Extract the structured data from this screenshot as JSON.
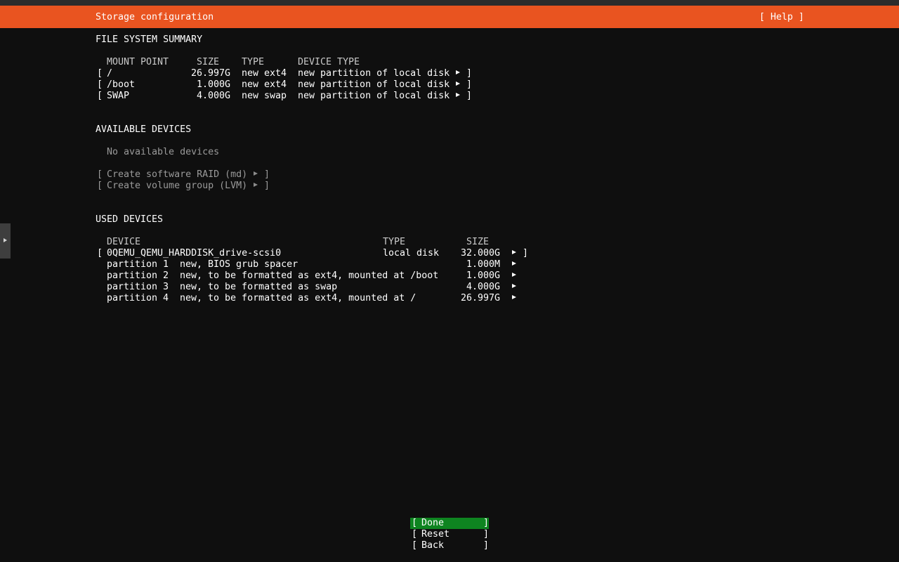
{
  "header": {
    "title": "Storage configuration",
    "help_label": "[ Help ]"
  },
  "fs_summary": {
    "title": "FILE SYSTEM SUMMARY",
    "columns": [
      "MOUNT POINT",
      "SIZE",
      "TYPE",
      "DEVICE TYPE"
    ],
    "rows": [
      {
        "mount": "/",
        "size": "26.997G",
        "type": "new ext4",
        "device_type": "new partition of local disk"
      },
      {
        "mount": "/boot",
        "size": "1.000G",
        "type": "new ext4",
        "device_type": "new partition of local disk"
      },
      {
        "mount": "SWAP",
        "size": "4.000G",
        "type": "new swap",
        "device_type": "new partition of local disk"
      }
    ]
  },
  "available": {
    "title": "AVAILABLE DEVICES",
    "empty_text": "No available devices",
    "actions": [
      {
        "label": "Create software RAID (md)"
      },
      {
        "label": "Create volume group (LVM)"
      }
    ]
  },
  "used": {
    "title": "USED DEVICES",
    "columns": [
      "DEVICE",
      "TYPE",
      "SIZE"
    ],
    "disk": {
      "name": "0QEMU_QEMU_HARDDISK_drive-scsi0",
      "type": "local disk",
      "size": "32.000G"
    },
    "partitions": [
      {
        "name": "partition 1",
        "desc": "new, BIOS grub spacer",
        "size": "1.000M"
      },
      {
        "name": "partition 2",
        "desc": "new, to be formatted as ext4, mounted at /boot",
        "size": "1.000G"
      },
      {
        "name": "partition 3",
        "desc": "new, to be formatted as swap",
        "size": "4.000G"
      },
      {
        "name": "partition 4",
        "desc": "new, to be formatted as ext4, mounted at /",
        "size": "26.997G"
      }
    ]
  },
  "buttons": {
    "done": "Done",
    "reset": "Reset",
    "back": "Back"
  },
  "colors": {
    "header": "#e95420",
    "focus": "#0e8420",
    "background": "#0f0f0f"
  }
}
